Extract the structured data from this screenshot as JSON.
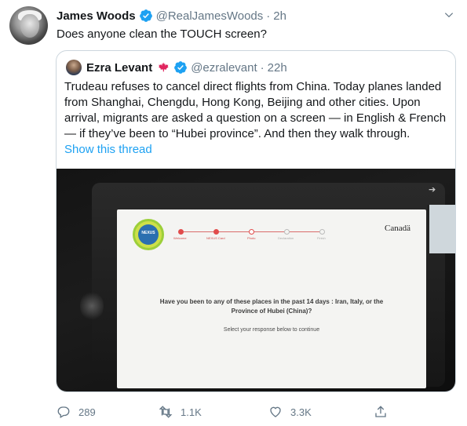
{
  "tweet": {
    "author_name": "James Woods",
    "author_handle": "@RealJamesWoods",
    "separator": "·",
    "time": "2h",
    "text": "Does anyone clean the TOUCH screen?"
  },
  "quoted_tweet": {
    "author_name": "Ezra Levant",
    "author_handle": "@ezralevant",
    "separator": "·",
    "time": "22h",
    "text_lines": [
      "Trudeau refuses to cancel direct flights from China. Today planes landed",
      "from Shanghai, Chengdu, Hong Kong, Beijing and other cities.  Upon",
      "arrival, migrants are asked a question on a screen — in English & French",
      "— if they’ve been to “Hubei province”. And then they walk through."
    ],
    "show_thread": "Show this thread"
  },
  "media": {
    "nexus_label": "NEXUS",
    "steps": [
      "Welcome",
      "NEXUS Card",
      "Photo",
      "Declaration",
      "Finish"
    ],
    "wordmark": "Canadä",
    "question_line1": "Have you been to any of these places in the past 14 days : Iran, Italy, or the",
    "question_line2": "Province of Hubei (China)?",
    "instruction": "Select your response below to continue"
  },
  "actions": {
    "reply_count": "289",
    "retweet_count": "1.1K",
    "like_count": "3.3K"
  },
  "colors": {
    "accent": "#1da1f2",
    "secondary_text": "#657786",
    "border": "#ccd6dd",
    "maple_leaf": "#e0245e"
  },
  "icons": {
    "verified": "verified-badge-icon",
    "caret": "chevron-down-icon",
    "maple": "maple-leaf-icon",
    "reply": "reply-icon",
    "retweet": "retweet-icon",
    "like": "heart-icon",
    "share": "share-icon"
  }
}
